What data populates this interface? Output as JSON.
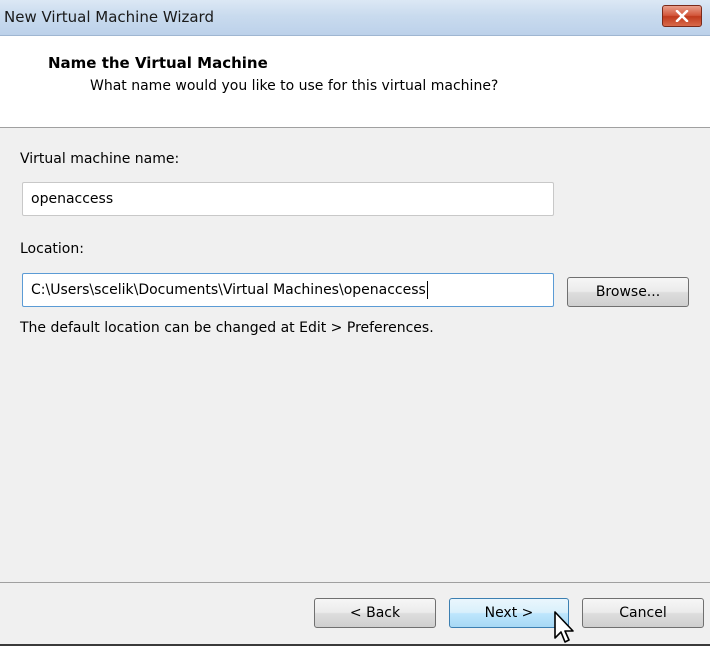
{
  "window": {
    "title": "New Virtual Machine Wizard",
    "close_icon": "close-icon"
  },
  "header": {
    "title": "Name the Virtual Machine",
    "subtitle": "What name would you like to use for this virtual machine?"
  },
  "form": {
    "vm_name_label": "Virtual machine name:",
    "vm_name_value": "openaccess",
    "location_label": "Location:",
    "location_value": "C:\\Users\\scelik\\Documents\\Virtual Machines\\openaccess",
    "browse_label": "Browse...",
    "hint": "The default location can be changed at Edit > Preferences."
  },
  "footer": {
    "back_label": "< Back",
    "next_label": "Next >",
    "cancel_label": "Cancel"
  },
  "colors": {
    "titlebar": "#c9dbee",
    "close_button": "#c0391c",
    "focus_border": "#5b9bd5",
    "hover_button": "#bee6fd"
  }
}
